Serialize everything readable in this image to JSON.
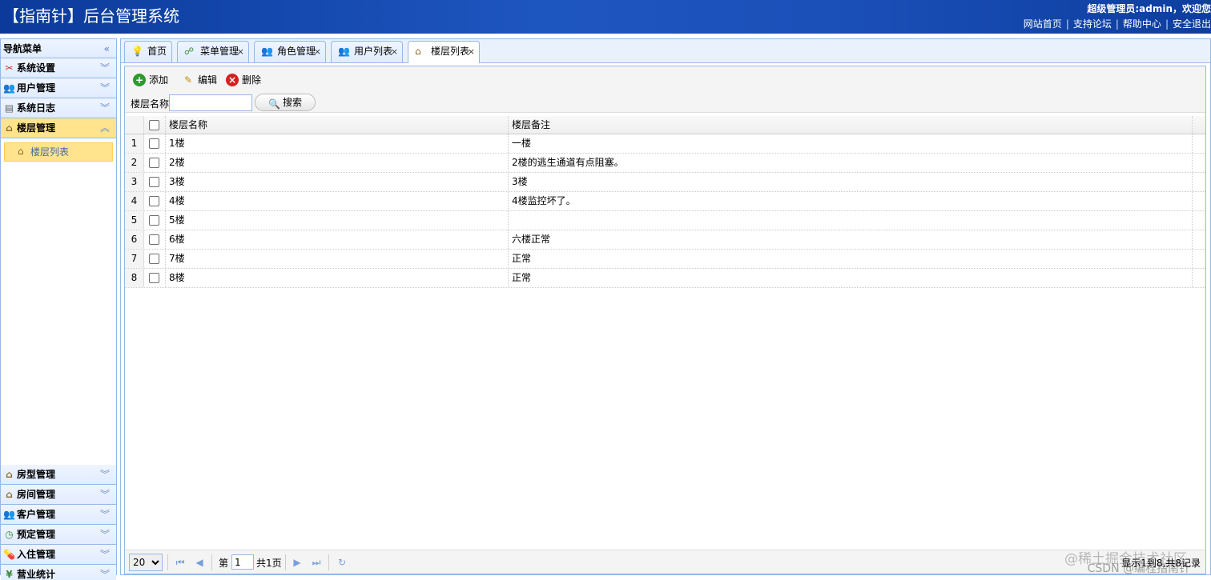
{
  "header": {
    "title": "【指南针】后台管理系统",
    "welcome": "超级管理员:admin，欢迎您",
    "links": [
      "网站首页",
      "支持论坛",
      "帮助中心",
      "安全退出"
    ]
  },
  "sidebar": {
    "title": "导航菜单",
    "collapse_icon": "double-chevron-left-icon",
    "menus_top": [
      {
        "label": "系统设置",
        "icon": "tools-icon"
      },
      {
        "label": "用户管理",
        "icon": "users-icon"
      },
      {
        "label": "系统日志",
        "icon": "log-icon"
      },
      {
        "label": "楼层管理",
        "icon": "house-icon",
        "active": true
      }
    ],
    "submenu": [
      {
        "label": "楼层列表",
        "icon": "house-icon"
      }
    ],
    "menus_bottom": [
      {
        "label": "房型管理",
        "icon": "house-icon"
      },
      {
        "label": "房间管理",
        "icon": "house-icon"
      },
      {
        "label": "客户管理",
        "icon": "users-icon"
      },
      {
        "label": "预定管理",
        "icon": "clock-icon"
      },
      {
        "label": "入住管理",
        "icon": "pill-icon"
      },
      {
        "label": "营业统计",
        "icon": "yen-icon"
      }
    ]
  },
  "tabs": [
    {
      "label": "首页",
      "icon": "lightbulb-icon",
      "closable": false
    },
    {
      "label": "菜单管理",
      "icon": "sitemap-icon",
      "closable": true
    },
    {
      "label": "角色管理",
      "icon": "users-icon",
      "closable": true
    },
    {
      "label": "用户列表",
      "icon": "users-icon",
      "closable": true
    },
    {
      "label": "楼层列表",
      "icon": "house-icon",
      "closable": true,
      "active": true
    }
  ],
  "toolbar": {
    "add_label": "添加",
    "edit_label": "编辑",
    "delete_label": "删除"
  },
  "search": {
    "label": "楼层名称:",
    "value": "",
    "button_label": "搜索"
  },
  "grid": {
    "columns": [
      "楼层名称",
      "楼层备注"
    ],
    "rows": [
      {
        "num": "1",
        "name": "1楼",
        "note": "一楼"
      },
      {
        "num": "2",
        "name": "2楼",
        "note": "2楼的逃生通道有点阻塞。"
      },
      {
        "num": "3",
        "name": "3楼",
        "note": "3楼"
      },
      {
        "num": "4",
        "name": "4楼",
        "note": "4楼监控坏了。"
      },
      {
        "num": "5",
        "name": "5楼",
        "note": ""
      },
      {
        "num": "6",
        "name": "6楼",
        "note": "六楼正常"
      },
      {
        "num": "7",
        "name": "7楼",
        "note": "正常"
      },
      {
        "num": "8",
        "name": "8楼",
        "note": "正常"
      }
    ]
  },
  "pager": {
    "page_size": "20",
    "page_prefix": "第",
    "page_value": "1",
    "page_suffix": "共1页",
    "info": "显示1到8,共8记录"
  },
  "watermark": {
    "line1": "@稀土掘金技术社区",
    "line2": "CSDN @编程指南针"
  }
}
